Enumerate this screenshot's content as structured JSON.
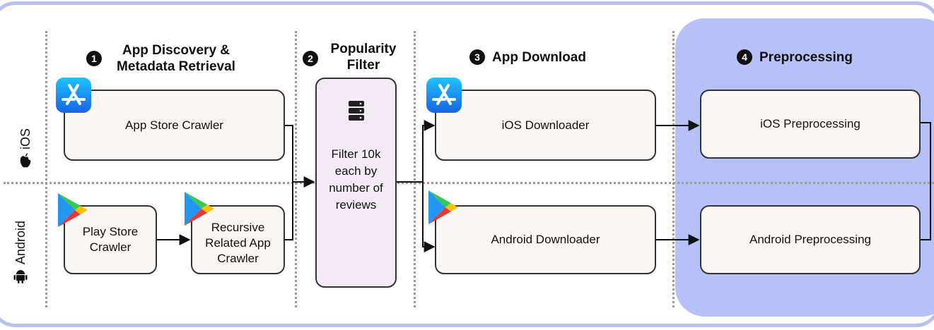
{
  "lanes": {
    "ios": "iOS",
    "android": "Android"
  },
  "stages": [
    {
      "num": "1",
      "title": "App Discovery & Metadata Retrieval"
    },
    {
      "num": "2",
      "title": "Popularity Filter"
    },
    {
      "num": "3",
      "title": "App Download"
    },
    {
      "num": "4",
      "title": "Preprocessing"
    }
  ],
  "nodes": {
    "app_store_crawler": "App Store Crawler",
    "play_store_crawler": "Play Store Crawler",
    "recursive_crawler": "Recursive Related App Crawler",
    "filter": "Filter 10k each by number of reviews",
    "ios_downloader": "iOS Downloader",
    "android_downloader": "Android Downloader",
    "ios_preprocessing": "iOS Preprocessing",
    "android_preprocessing": "Android Preprocessing"
  },
  "icons": [
    "app-store-icon",
    "google-play-icon",
    "database-icon",
    "apple-icon",
    "android-icon"
  ],
  "colors": {
    "preprocessing_bg": "#b6c1f8",
    "filter_bg": "#f4eaf6",
    "box_bg": "#fcf7f5",
    "frame": "#b7c1f0"
  }
}
